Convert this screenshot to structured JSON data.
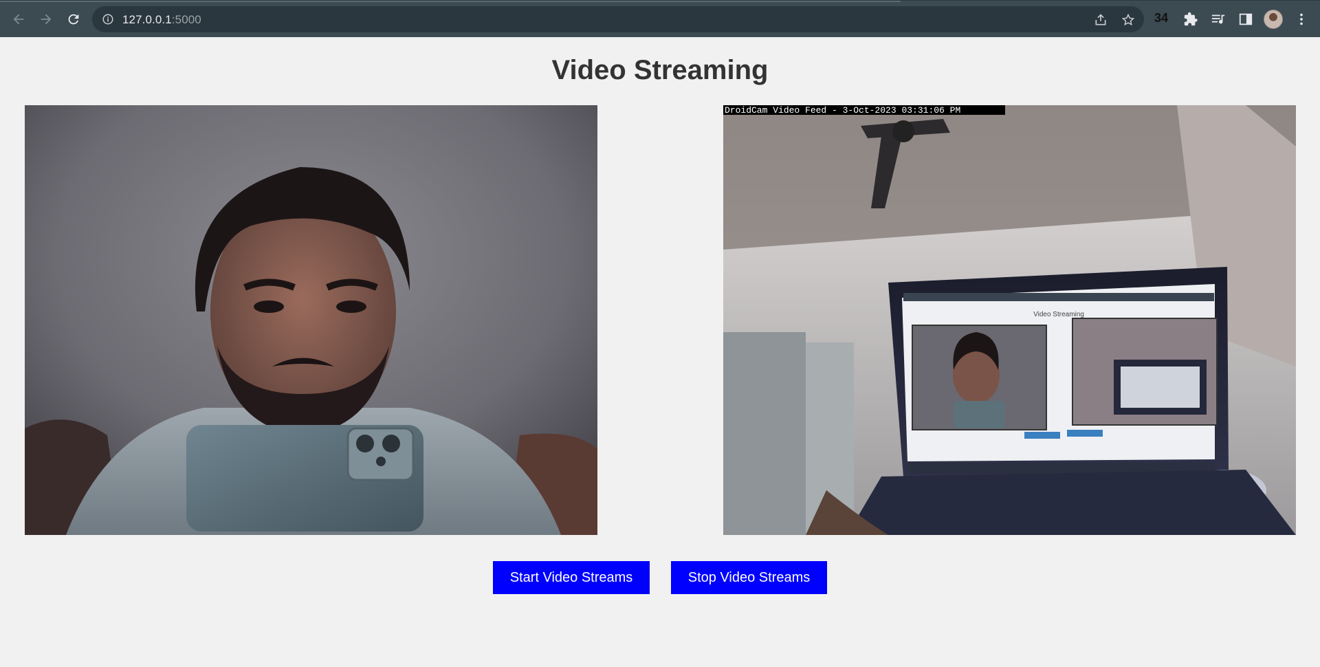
{
  "browser": {
    "url_host": "127.0.0.1",
    "url_port": ":5000",
    "extension_badge": "34",
    "icons": [
      "back-icon",
      "forward-icon",
      "reload-icon",
      "info-icon",
      "share-icon",
      "star-icon",
      "puzzle-icon",
      "media-icon",
      "sidepanel-icon",
      "menu-icon"
    ]
  },
  "page": {
    "title": "Video Streaming",
    "left_feed": {
      "kind": "webcam-feed"
    },
    "right_feed": {
      "kind": "droidcam-feed",
      "overlay_text": "DroidCam Video Feed -  3-Oct-2023 03:31:06 PM",
      "laptop_screen_title": "Video Streaming"
    },
    "buttons": {
      "start_label": "Start Video Streams",
      "stop_label": "Stop Video Streams"
    },
    "colors": {
      "background": "#f1f1f1",
      "button": "#0000ff",
      "title": "#333333",
      "chrome": "#3c4a52"
    }
  }
}
